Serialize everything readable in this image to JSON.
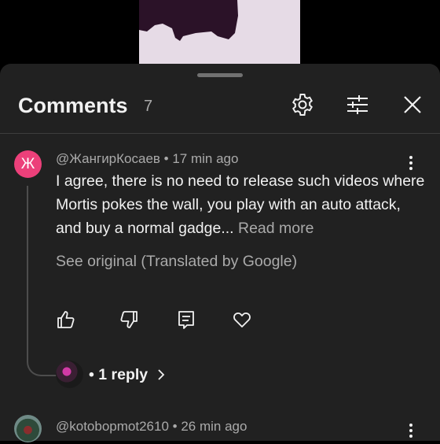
{
  "header": {
    "title": "Comments",
    "count": "7"
  },
  "icons": {
    "settings": "gear-icon",
    "filter": "sliders-icon",
    "close": "close-icon",
    "more": "more-vertical-icon",
    "like": "thumb-up-icon",
    "dislike": "thumb-down-icon",
    "reply": "comment-reply-icon",
    "heart": "heart-icon",
    "chevron": "chevron-right-icon"
  },
  "comments": [
    {
      "avatar_letter": "Ж",
      "avatar_color": "#ec407a",
      "author": "@ЖангирКосаев",
      "separator": " • ",
      "time": "17 min ago",
      "text": "I agree, there is no need to release such videos where Mortis pokes the wall, you play with an auto attack, and buy a normal gadge... ",
      "read_more": "Read more",
      "see_original": "See original (Translated by Google)",
      "replies_label": "• 1 reply"
    },
    {
      "author": "@kotobopmot2610",
      "separator": " • ",
      "time": "26 min ago"
    }
  ],
  "colors": {
    "sheet_bg": "#212121",
    "text_primary": "#f1f1f1",
    "text_secondary": "#aaaaaa"
  }
}
